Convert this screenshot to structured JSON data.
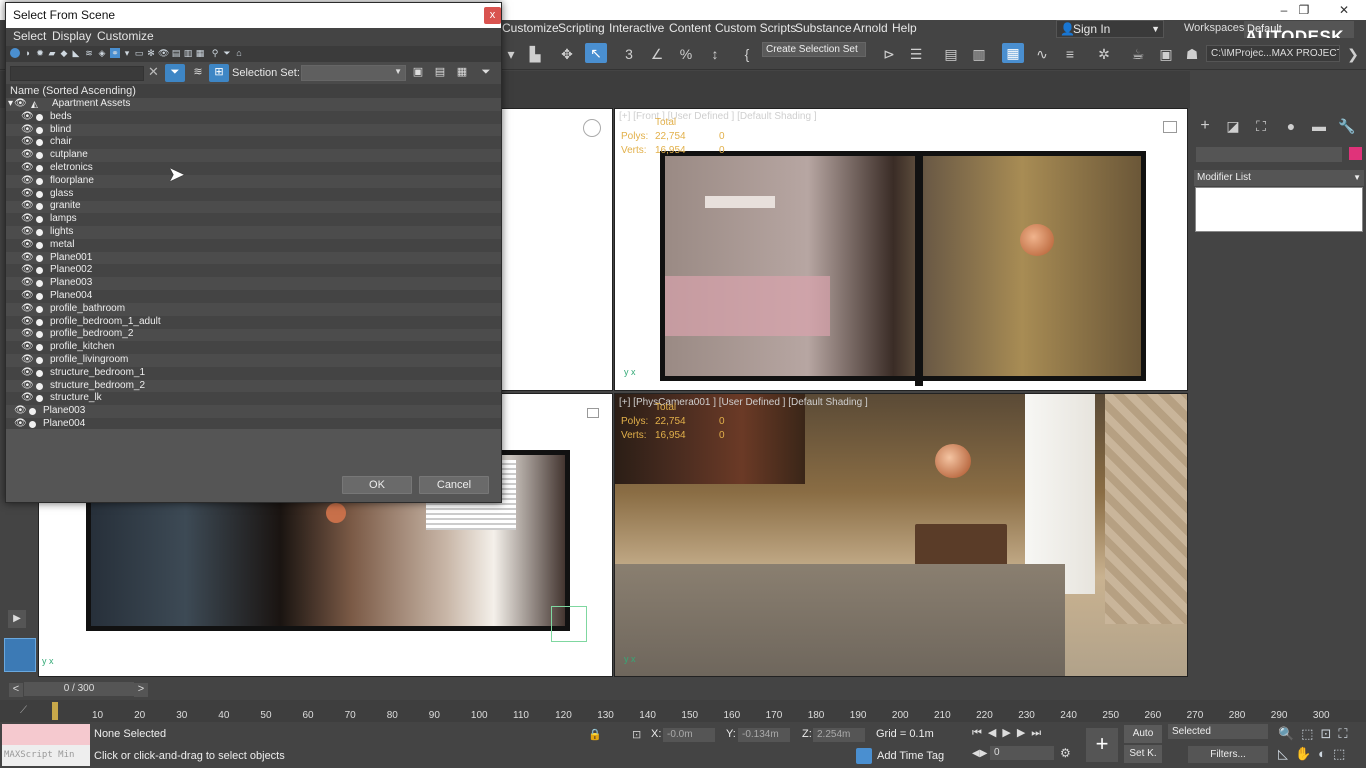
{
  "window": {
    "minimize": "–",
    "restore": "❐",
    "close": "✕"
  },
  "menubar": {
    "items": [
      "Customize",
      "Scripting",
      "Interactive",
      "Content",
      "Custom Scripts",
      "Substance",
      "Arnold",
      "Help"
    ],
    "sign_in": "Sign In",
    "workspaces_label": "Workspaces:",
    "workspaces_value": "Default",
    "brand": "AUTODESK."
  },
  "toolbar": {
    "selection_set": "Create Selection Set",
    "project_path": "C:\\IMProjec...MAX PROJECT"
  },
  "dialog": {
    "title": "Select From Scene",
    "close": "x",
    "menu": [
      "Select",
      "Display",
      "Customize"
    ],
    "selection_set_label": "Selection Set:",
    "column_header": "Name (Sorted Ascending)",
    "tree": [
      {
        "label": "Apartment Assets",
        "level": 0
      },
      {
        "label": "beds",
        "level": 1
      },
      {
        "label": "blind",
        "level": 1
      },
      {
        "label": "chair",
        "level": 1
      },
      {
        "label": "cutplane",
        "level": 1
      },
      {
        "label": "eletronics",
        "level": 1
      },
      {
        "label": "floorplane",
        "level": 1
      },
      {
        "label": "glass",
        "level": 1
      },
      {
        "label": "granite",
        "level": 1
      },
      {
        "label": "lamps",
        "level": 1
      },
      {
        "label": "lights",
        "level": 1
      },
      {
        "label": "metal",
        "level": 1
      },
      {
        "label": "Plane001",
        "level": 1
      },
      {
        "label": "Plane002",
        "level": 1
      },
      {
        "label": "Plane003",
        "level": 1
      },
      {
        "label": "Plane004",
        "level": 1
      },
      {
        "label": "profile_bathroom",
        "level": 1
      },
      {
        "label": "profile_bedroom_1_adult",
        "level": 1
      },
      {
        "label": "profile_bedroom_2",
        "level": 1
      },
      {
        "label": "profile_kitchen",
        "level": 1
      },
      {
        "label": "profile_livingroom",
        "level": 1
      },
      {
        "label": "structure_bedroom_1",
        "level": 1
      },
      {
        "label": "structure_bedroom_2",
        "level": 1
      },
      {
        "label": "structure_lk",
        "level": 1
      },
      {
        "label": "Plane003",
        "level": 0
      },
      {
        "label": "Plane004",
        "level": 0
      }
    ],
    "ok": "OK",
    "cancel": "Cancel"
  },
  "viewports": {
    "front": {
      "label": "[+] [Front ] [User Defined ] [Default Shading ]",
      "total": "Total",
      "polys_label": "Polys:",
      "polys": "22,754",
      "polys_sel": "0",
      "verts_label": "Verts:",
      "verts": "16,954",
      "verts_sel": "0"
    },
    "camera": {
      "label": "[+] [PhysCamera001 ] [User Defined ] [Default Shading ]",
      "total": "Total",
      "polys_label": "Polys:",
      "polys": "22,754",
      "polys_sel": "0",
      "verts_label": "Verts:",
      "verts": "16,954",
      "verts_sel": "0"
    },
    "axis": "y x"
  },
  "command_panel": {
    "modifier_list": "Modifier List"
  },
  "timeline": {
    "frame": "0 / 300",
    "prev": "<",
    "next": ">",
    "ticks": [
      "10",
      "20",
      "30",
      "40",
      "50",
      "60",
      "70",
      "80",
      "90",
      "100",
      "110",
      "120",
      "130",
      "140",
      "150",
      "160",
      "170",
      "180",
      "190",
      "200",
      "210",
      "220",
      "230",
      "240",
      "250",
      "260",
      "270",
      "280",
      "290",
      "300"
    ]
  },
  "status": {
    "maxscript": "MAXScript Min",
    "none_selected": "None Selected",
    "prompt": "Click or click-and-drag to select objects",
    "x_label": "X:",
    "x": "-0.0m",
    "y_label": "Y:",
    "y": "-0.134m",
    "z_label": "Z:",
    "z": "2.254m",
    "grid": "Grid = 0.1m",
    "add_time_tag": "Add Time Tag",
    "auto": "Auto",
    "setk": "Set K.",
    "selected": "Selected",
    "filters": "Filters...",
    "frame_value": "0"
  }
}
